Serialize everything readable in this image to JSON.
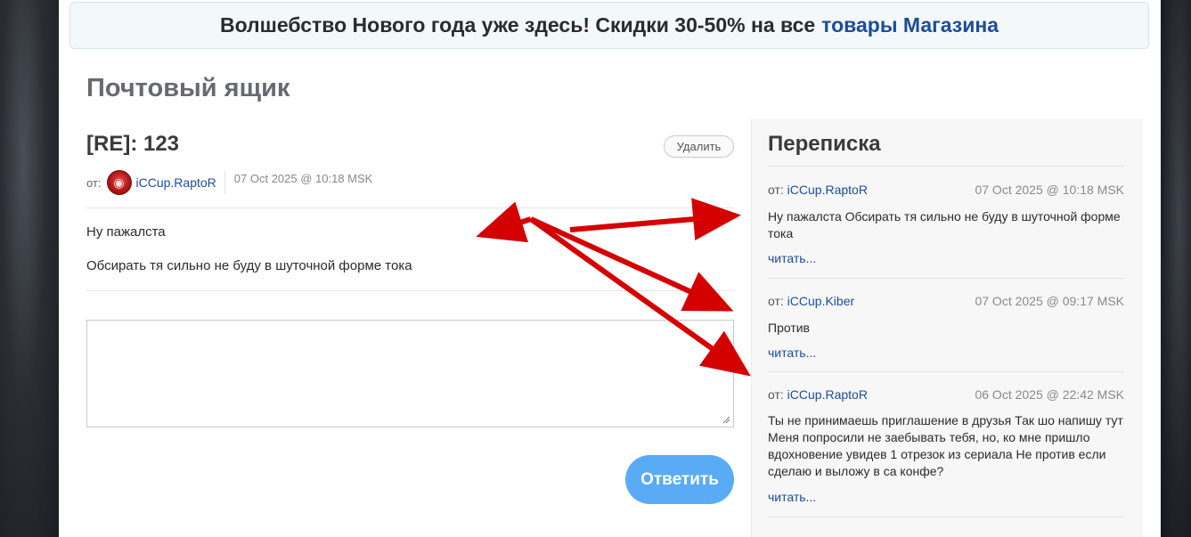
{
  "promo": {
    "text": "Волшебство Нового года уже здесь! Скидки 30-50% на все",
    "link": "товары Магазина"
  },
  "page_title": "Почтовый ящик",
  "message": {
    "subject": "[RE]: 123",
    "delete_label": "Удалить",
    "from_label": "от:",
    "author": "iCCup.RaptoR",
    "date": "07 Oct 2025 @ 10:18 MSK",
    "lines": [
      "Ну пажалста",
      "Обсирать тя сильно не буду в шуточной форме тока"
    ]
  },
  "reply": {
    "value": "",
    "button_label": "Ответить"
  },
  "conversation": {
    "title": "Переписка",
    "items": [
      {
        "from_label": "от:",
        "author": "iCCup.RaptoR",
        "date": "07 Oct 2025 @ 10:18 MSK",
        "text": "Ну пажалста Обсирать тя сильно не буду в шуточной форме тока",
        "read": "читать..."
      },
      {
        "from_label": "от:",
        "author": "iCCup.Kiber",
        "date": "07 Oct 2025 @ 09:17 MSK",
        "text": "Против",
        "read": "читать..."
      },
      {
        "from_label": "от:",
        "author": "iCCup.RaptoR",
        "date": "06 Oct 2025 @ 22:42 MSK",
        "text": "Ты не принимаешь приглашение в друзья Так шо напишу тут Меня попросили не заебывать тебя, но, ко мне пришло вдохновение увидев 1 отрезок из сериала Не против если сделаю и выложу в са конфе?",
        "read": "читать..."
      }
    ]
  },
  "colors": {
    "link": "#1d4c9a",
    "reply_button": "#5aabf5",
    "annotation_arrow": "#d40000"
  }
}
